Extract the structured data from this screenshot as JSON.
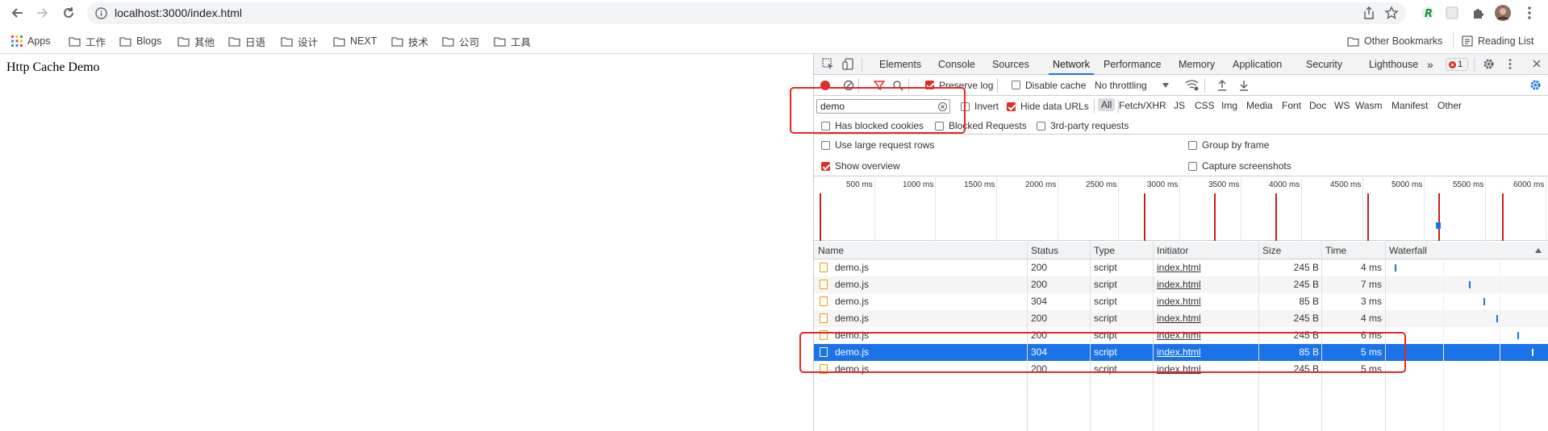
{
  "browser": {
    "url": "localhost:3000/index.html",
    "bookmarks": [
      "Apps",
      "工作",
      "Blogs",
      "其他",
      "日语",
      "设计",
      "NEXT",
      "技术",
      "公司",
      "工具"
    ],
    "other_bookmarks": "Other Bookmarks",
    "reading_list": "Reading List"
  },
  "page": {
    "heading": "Http Cache Demo"
  },
  "devtools": {
    "tabs": [
      "Elements",
      "Console",
      "Sources",
      "Network",
      "Performance",
      "Memory",
      "Application",
      "Security",
      "Lighthouse"
    ],
    "active_tab": "Network",
    "error_count": "1",
    "toolbar": {
      "preserve_log": "Preserve log",
      "disable_cache": "Disable cache",
      "throttling": "No throttling"
    },
    "filter": {
      "value": "demo",
      "invert": "Invert",
      "hide_data_urls": "Hide data URLs",
      "types": [
        "All",
        "Fetch/XHR",
        "JS",
        "CSS",
        "Img",
        "Media",
        "Font",
        "Doc",
        "WS",
        "Wasm",
        "Manifest",
        "Other"
      ],
      "has_blocked_cookies": "Has blocked cookies",
      "blocked_requests": "Blocked Requests",
      "third_party": "3rd-party requests"
    },
    "settings": {
      "large_rows": "Use large request rows",
      "group_by_frame": "Group by frame",
      "show_overview": "Show overview",
      "capture_screenshots": "Capture screenshots"
    },
    "overview_ticks": [
      "500 ms",
      "1000 ms",
      "1500 ms",
      "2000 ms",
      "2500 ms",
      "3000 ms",
      "3500 ms",
      "4000 ms",
      "4500 ms",
      "5000 ms",
      "5500 ms",
      "6000 ms"
    ],
    "table": {
      "columns": [
        "Name",
        "Status",
        "Type",
        "Initiator",
        "Size",
        "Time",
        "Waterfall"
      ],
      "rows": [
        {
          "name": "demo.js",
          "status": "200",
          "type": "script",
          "initiator": "index.html",
          "size": "245 B",
          "time": "4 ms"
        },
        {
          "name": "demo.js",
          "status": "200",
          "type": "script",
          "initiator": "index.html",
          "size": "245 B",
          "time": "7 ms"
        },
        {
          "name": "demo.js",
          "status": "304",
          "type": "script",
          "initiator": "index.html",
          "size": "85 B",
          "time": "3 ms"
        },
        {
          "name": "demo.js",
          "status": "200",
          "type": "script",
          "initiator": "index.html",
          "size": "245 B",
          "time": "4 ms"
        },
        {
          "name": "demo.js",
          "status": "200",
          "type": "script",
          "initiator": "index.html",
          "size": "245 B",
          "time": "6 ms"
        },
        {
          "name": "demo.js",
          "status": "304",
          "type": "script",
          "initiator": "index.html",
          "size": "85 B",
          "time": "5 ms"
        },
        {
          "name": "demo.js",
          "status": "200",
          "type": "script",
          "initiator": "index.html",
          "size": "245 B",
          "time": "5 ms"
        }
      ],
      "selected_row": 5
    }
  },
  "colors": {
    "accent": "#1a73e8",
    "highlight": "#e8262b",
    "record": "#d93025"
  }
}
